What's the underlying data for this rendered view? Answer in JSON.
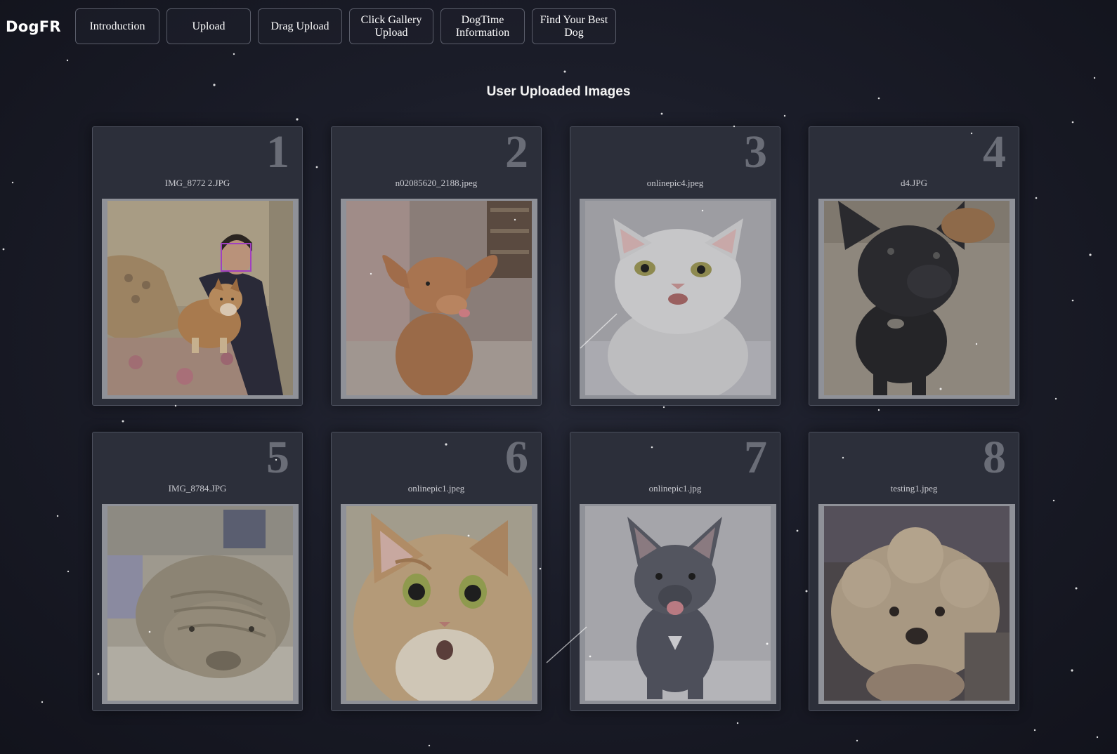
{
  "app": {
    "logo": "DogFR"
  },
  "nav": [
    {
      "label": "Introduction"
    },
    {
      "label": "Upload"
    },
    {
      "label": "Drag Upload"
    },
    {
      "label": "Click Gallery Upload"
    },
    {
      "label": "DogTime Information"
    },
    {
      "label": "Find Your Best Dog"
    }
  ],
  "main": {
    "title": "User Uploaded Images",
    "cards": [
      {
        "number": "1",
        "filename": "IMG_8772 2.JPG",
        "subject": "woman-with-shiba-inu"
      },
      {
        "number": "2",
        "filename": "n02085620_2188.jpeg",
        "subject": "chihuahua-puppy"
      },
      {
        "number": "3",
        "filename": "onlinepic4.jpeg",
        "subject": "white-cat"
      },
      {
        "number": "4",
        "filename": "d4.JPG",
        "subject": "black-french-bulldog"
      },
      {
        "number": "5",
        "filename": "IMG_8784.JPG",
        "subject": "shar-pei"
      },
      {
        "number": "6",
        "filename": "onlinepic1.jpeg",
        "subject": "orange-tabby-cat"
      },
      {
        "number": "7",
        "filename": "onlinepic1.jpg",
        "subject": "gray-french-bulldog-puppy"
      },
      {
        "number": "8",
        "filename": "testing1.jpeg",
        "subject": "fluffy-poodle"
      }
    ]
  },
  "colors": {
    "background": "#1b1d29",
    "card": "#2c2f3a",
    "face_box": "#a040c0"
  }
}
